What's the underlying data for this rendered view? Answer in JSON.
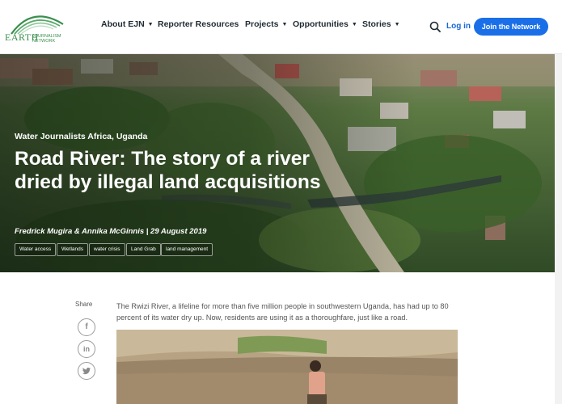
{
  "header": {
    "logo": {
      "main": "EARTH",
      "sub": "JOURNALISM NETWORK"
    },
    "nav": [
      {
        "label": "About EJN",
        "dropdown": true
      },
      {
        "label": "Reporter Resources",
        "dropdown": false
      },
      {
        "label": "Projects",
        "dropdown": true
      },
      {
        "label": "Opportunities",
        "dropdown": true
      },
      {
        "label": "Stories",
        "dropdown": true
      }
    ],
    "login": "Log in",
    "join": "Join the Network"
  },
  "hero": {
    "kicker": "Water Journalists Africa, Uganda",
    "title": "Road River: The story of a river dried by illegal land acquisitions",
    "byline": "Fredrick Mugira & Annika McGinnis | 29 August 2019",
    "tags": [
      "Water access",
      "Wetlands",
      "water crisis",
      "Land Grab",
      "land management"
    ]
  },
  "article": {
    "share_label": "Share",
    "share_icons": [
      "facebook-icon",
      "linkedin-icon",
      "twitter-icon"
    ],
    "intro": "The Rwizi River, a lifeline for more than five million people in southwestern Uganda, has had up to 80 percent of its water dry up. Now, residents are using it as a thoroughfare, just like a road."
  },
  "colors": {
    "accent": "#1a6fe8",
    "logo_green": "#3a8f4d",
    "link": "#1a66d9"
  }
}
